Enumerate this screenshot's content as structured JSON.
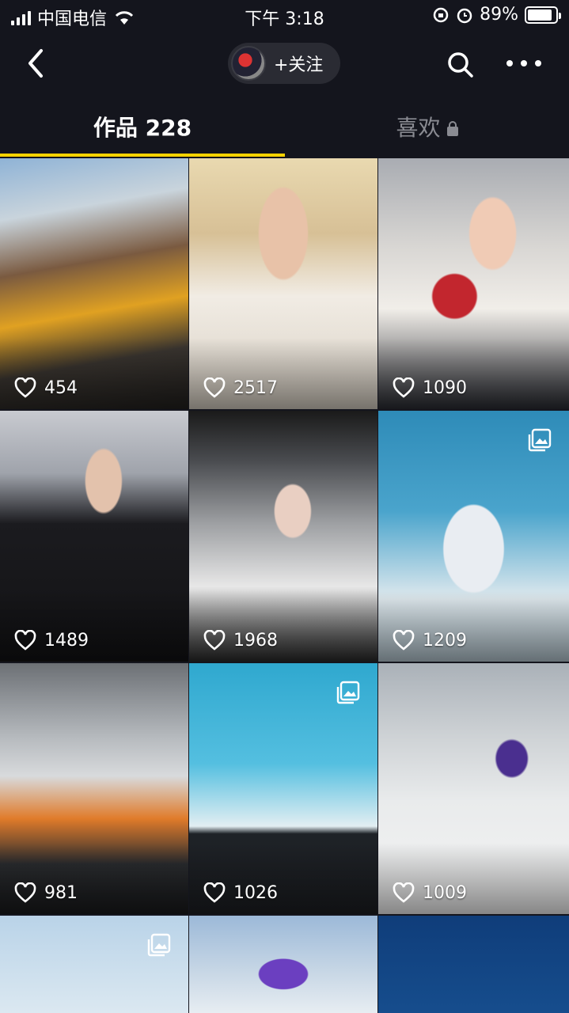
{
  "status_bar": {
    "carrier": "中国电信",
    "time": "下午 3:18",
    "battery": "89%",
    "battery_level": 0.89
  },
  "nav": {
    "follow_label": "+关注"
  },
  "tabs": {
    "works_label": "作品 228",
    "likes_label": "喜欢"
  },
  "grid": {
    "items": [
      {
        "likes": "454",
        "gallery": false
      },
      {
        "likes": "2517",
        "gallery": false
      },
      {
        "likes": "1090",
        "gallery": false
      },
      {
        "likes": "1489",
        "gallery": false
      },
      {
        "likes": "1968",
        "gallery": false
      },
      {
        "likes": "1209",
        "gallery": true
      },
      {
        "likes": "981",
        "gallery": false
      },
      {
        "likes": "1026",
        "gallery": true
      },
      {
        "likes": "1009",
        "gallery": false
      }
    ]
  },
  "colors": {
    "background": "#14151d",
    "tab_indicator": "#fed300",
    "inactive_tab": "#8a8b92"
  }
}
